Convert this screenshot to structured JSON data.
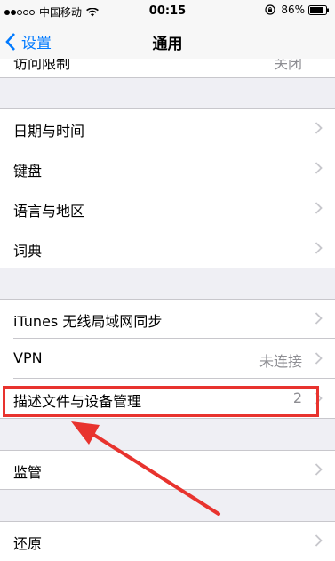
{
  "status_bar": {
    "carrier": "中国移动",
    "time": "00:15",
    "battery": "86%"
  },
  "nav": {
    "back_label": "设置",
    "title": "通用"
  },
  "rows": {
    "partial": {
      "label": "访问限制",
      "detail": "关闭"
    },
    "date_time": {
      "label": "日期与时间"
    },
    "keyboard": {
      "label": "键盘"
    },
    "language": {
      "label": "语言与地区"
    },
    "dictionary": {
      "label": "词典"
    },
    "itunes_sync": {
      "label": "iTunes 无线局域网同步"
    },
    "vpn": {
      "label": "VPN",
      "detail": "未连接"
    },
    "profiles": {
      "label": "描述文件与设备管理",
      "detail": "2"
    },
    "supervision": {
      "label": "监管"
    },
    "reset": {
      "label": "还原"
    }
  },
  "colors": {
    "accent": "#007aff",
    "background": "#efeff4",
    "annotation": "#e8332e"
  }
}
